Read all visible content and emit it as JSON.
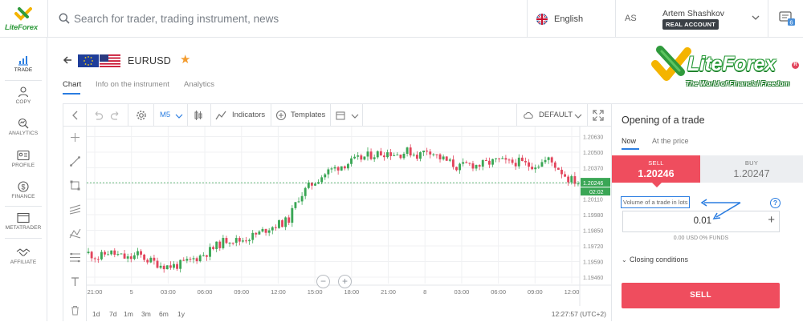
{
  "brand": {
    "small_logo_text": "LiteForex",
    "big_logo_text": "LiteForex",
    "tagline": "The World of Financial Freedom"
  },
  "search": {
    "placeholder": "Search for trader, trading instrument, news"
  },
  "language": {
    "label": "English"
  },
  "user": {
    "initials": "AS",
    "name": "Artem Shashkov",
    "account_type": "REAL ACCOUNT",
    "messages_count": "6"
  },
  "sidebar": {
    "items": [
      {
        "label": "TRADE",
        "icon": "trade-icon"
      },
      {
        "label": "COPY",
        "icon": "copy-icon"
      },
      {
        "label": "ANALYTICS",
        "icon": "analytics-icon"
      },
      {
        "label": "PROFILE",
        "icon": "profile-icon"
      },
      {
        "label": "FINANCE",
        "icon": "finance-icon"
      },
      {
        "label": "METATRADER",
        "icon": "metatrader-icon"
      },
      {
        "label": "AFFILIATE",
        "icon": "affiliate-icon"
      }
    ]
  },
  "instrument": {
    "symbol": "EURUSD",
    "favorite": true,
    "tabs": [
      "Chart",
      "Info on the instrument",
      "Analytics"
    ],
    "active_tab": "Chart"
  },
  "chart_toolbar": {
    "timeframe": "M5",
    "indicators_label": "Indicators",
    "templates_label": "Templates",
    "layout_label": "DEFAULT"
  },
  "periods": [
    "1d",
    "7d",
    "1m",
    "3m",
    "6m",
    "1y"
  ],
  "clock": "12:27:57 (UTC+2)",
  "chart_data": {
    "type": "candlestick",
    "x_tick_labels": [
      "21:00",
      "5",
      "03:00",
      "06:00",
      "09:00",
      "12:00",
      "15:00",
      "18:00",
      "21:00",
      "8",
      "03:00",
      "06:00",
      "09:00",
      "12:00"
    ],
    "y_tick_labels": [
      "1.20630",
      "1.20500",
      "1.20370",
      "1.20240",
      "1.20110",
      "1.19980",
      "1.19850",
      "1.19720",
      "1.19590",
      "1.19460"
    ],
    "ylim": [
      1.1946,
      1.2066
    ],
    "current_price": "1.20246",
    "countdown": "02:02",
    "close_path": [
      1.1966,
      1.1962,
      1.1967,
      1.1964,
      1.1961,
      1.1965,
      1.196,
      1.1957,
      1.1955,
      1.1956,
      1.1959,
      1.1963,
      1.1967,
      1.1973,
      1.1978,
      1.1976,
      1.1979,
      1.1982,
      1.1987,
      1.199,
      1.1993,
      1.2012,
      1.2021,
      1.2028,
      1.2034,
      1.2038,
      1.2041,
      1.2044,
      1.2047,
      1.2049,
      1.205,
      1.2048,
      1.2051,
      1.2047,
      1.2053,
      1.2046,
      1.2042,
      1.2037,
      1.204,
      1.2039,
      1.2041,
      1.2043,
      1.2041,
      1.2042,
      1.2039,
      1.204,
      1.2044,
      1.2037,
      1.2028,
      1.2025
    ],
    "colors": {
      "up": "#3aa655",
      "down": "#e2445c",
      "price_line": "#3aa655"
    }
  },
  "trade": {
    "title": "Opening of a trade",
    "tabs": [
      "Now",
      "At the price"
    ],
    "sell_label": "SELL",
    "sell_price": "1.20246",
    "buy_label": "BUY",
    "buy_price": "1.20247",
    "volume_label": "Volume of a trade in lots",
    "volume_value": "0.01",
    "funds_text": "0.00 USD  0% FUNDS",
    "closing_conditions": "Closing conditions",
    "sell_button": "SELL"
  },
  "colors": {
    "accent": "#2a7de1",
    "sell": "#ef4d5e",
    "brand_green": "#2f9a3c"
  }
}
